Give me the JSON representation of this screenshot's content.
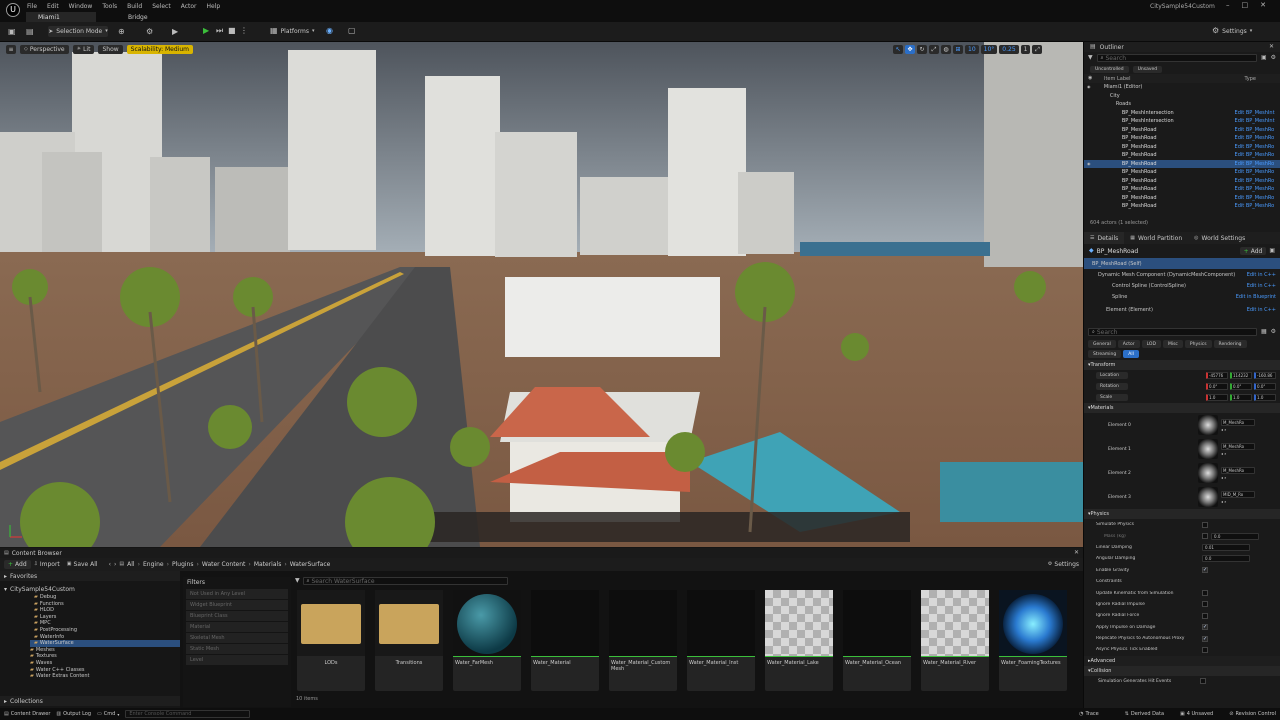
{
  "titlebar": {
    "menu": [
      "File",
      "Edit",
      "Window",
      "Tools",
      "Build",
      "Select",
      "Actor",
      "Help"
    ],
    "tabs": [
      "Miami1",
      "Bridge"
    ],
    "project": "CitySample54Custom"
  },
  "toolbar": {
    "mode": "Selection Mode",
    "platforms": "Platforms",
    "settings": "Settings"
  },
  "viewport": {
    "perspective": "Perspective",
    "lit": "Lit",
    "show": "Show",
    "scalability": "Scalability: Medium",
    "snap_angle": "10°",
    "grid": "10",
    "scale": "0.25",
    "camera": "1"
  },
  "outliner": {
    "title": "Outliner",
    "search_placeholder": "Search",
    "filters": [
      "Uncontrolled",
      "Unsaved"
    ],
    "col_label": "Item Label",
    "col_type": "Type",
    "tree": [
      {
        "label": "Miami1 (Editor)",
        "type": "",
        "indent": 0
      },
      {
        "label": "City",
        "type": "",
        "indent": 1
      },
      {
        "label": "Roads",
        "type": "",
        "indent": 2
      },
      {
        "label": "BP_MeshIntersection",
        "type": "Edit BP_MeshInt",
        "indent": 3
      },
      {
        "label": "BP_MeshIntersection",
        "type": "Edit BP_MeshInt",
        "indent": 3
      },
      {
        "label": "BP_MeshRoad",
        "type": "Edit BP_MeshRo",
        "indent": 3
      },
      {
        "label": "BP_MeshRoad",
        "type": "Edit BP_MeshRo",
        "indent": 3
      },
      {
        "label": "BP_MeshRoad",
        "type": "Edit BP_MeshRo",
        "indent": 3
      },
      {
        "label": "BP_MeshRoad",
        "type": "Edit BP_MeshRo",
        "indent": 3
      },
      {
        "label": "BP_MeshRoad",
        "type": "Edit BP_MeshRo",
        "indent": 3,
        "selected": true
      },
      {
        "label": "BP_MeshRoad",
        "type": "Edit BP_MeshRo",
        "indent": 3
      },
      {
        "label": "BP_MeshRoad",
        "type": "Edit BP_MeshRo",
        "indent": 3
      },
      {
        "label": "BP_MeshRoad",
        "type": "Edit BP_MeshRo",
        "indent": 3
      },
      {
        "label": "BP_MeshRoad",
        "type": "Edit BP_MeshRo",
        "indent": 3
      },
      {
        "label": "BP_MeshRoad",
        "type": "Edit BP_MeshRo",
        "indent": 3
      }
    ],
    "count": "604 actors (1 selected)"
  },
  "details": {
    "tabs": [
      "Details",
      "World Partition",
      "World Settings"
    ],
    "actor": "BP_MeshRoad",
    "add": "Add",
    "components": [
      {
        "label": "BP_MeshRoad (Self)",
        "link": ""
      },
      {
        "label": "Dynamic Mesh Component (DynamicMeshComponent)",
        "link": "Edit in C++"
      },
      {
        "label": "Control Spline (ControlSpline)",
        "link": "Edit in C++"
      },
      {
        "label": "Spline",
        "link": "Edit in Blueprint"
      },
      {
        "label": "Element (Element)",
        "link": "Edit in C++"
      }
    ],
    "search_placeholder": "Search",
    "cat_tabs": [
      "General",
      "Actor",
      "LOD",
      "Misc",
      "Physics",
      "Rendering",
      "Streaming",
      "All"
    ],
    "transform_title": "Transform",
    "transform": [
      {
        "label": "Location",
        "x": "-45776",
        "y": "114232",
        "z": "-160.86"
      },
      {
        "label": "Rotation",
        "x": "0.0°",
        "y": "0.0°",
        "z": "0.0°"
      },
      {
        "label": "Scale",
        "x": "1.0",
        "y": "1.0",
        "z": "1.0"
      }
    ],
    "materials_title": "Materials",
    "materials": [
      {
        "label": "Element 0",
        "name": "M_MeshRo"
      },
      {
        "label": "Element 1",
        "name": "M_MeshRo"
      },
      {
        "label": "Element 2",
        "name": "M_MeshRo"
      },
      {
        "label": "Element 3",
        "name": "MID_M_Ro"
      }
    ],
    "physics_title": "Physics",
    "physics": [
      {
        "label": "Simulate Physics",
        "checked": false,
        "value": ""
      },
      {
        "label": "Mass (kg)",
        "checked": false,
        "value": "0.0"
      },
      {
        "label": "Linear Damping",
        "checked": null,
        "value": "0.01"
      },
      {
        "label": "Angular Damping",
        "checked": null,
        "value": "0.0"
      },
      {
        "label": "Enable Gravity",
        "checked": true,
        "value": ""
      },
      {
        "label": "Constraints",
        "checked": null,
        "value": ""
      },
      {
        "label": "Update Kinematic from Simulation",
        "checked": false,
        "value": ""
      },
      {
        "label": "Ignore Radial Impulse",
        "checked": false,
        "value": ""
      },
      {
        "label": "Ignore Radial Force",
        "checked": false,
        "value": ""
      },
      {
        "label": "Apply Impulse on Damage",
        "checked": true,
        "value": ""
      },
      {
        "label": "Replicate Physics to Autonomous Proxy",
        "checked": true,
        "value": ""
      },
      {
        "label": "Async Physics Tick Enabled",
        "checked": false,
        "value": ""
      }
    ],
    "advanced": "Advanced",
    "collision_title": "Collision",
    "collision_row": "Simulation Generates Hit Events"
  },
  "content_browser": {
    "title": "Content Browser",
    "add": "Add",
    "import": "Import",
    "save_all": "Save All",
    "breadcrumb": [
      "All",
      "Engine",
      "Plugins",
      "Water Content",
      "Materials",
      "WaterSurface"
    ],
    "settings": "Settings",
    "favorites": "Favorites",
    "root": "CitySample54Custom",
    "tree": [
      "Debug",
      "Functions",
      "HLOD",
      "Layers",
      "MPC",
      "PostProcessing",
      "WaterInfo",
      "WaterSurface",
      "Meshes",
      "Textures",
      "Waves",
      "Water C++ Classes",
      "Water Extras Content"
    ],
    "collections": "Collections",
    "filters_title": "Filters",
    "filters": [
      "Not Used in Any Level",
      "Widget Blueprint",
      "Blueprint Class",
      "Material",
      "Skeletal Mesh",
      "Static Mesh",
      "Level"
    ],
    "search_placeholder": "Search WaterSurface",
    "assets": [
      "LODs",
      "Transitions",
      "Water_FarMesh",
      "Water_Material",
      "Water_Material_Custom Mesh",
      "Water_Material_Inst",
      "Water_Material_Lake",
      "Water_Material_Ocean",
      "Water_Material_River",
      "Water_FoamingTextures"
    ],
    "count": "10 items"
  },
  "statusbar": {
    "content_drawer": "Content Drawer",
    "output_log": "Output Log",
    "cmd": "Cmd",
    "console_placeholder": "Enter Console Command",
    "trace": "Trace",
    "derived": "Derived Data",
    "unsaved": "4 Unsaved",
    "revision": "Revision Control"
  }
}
